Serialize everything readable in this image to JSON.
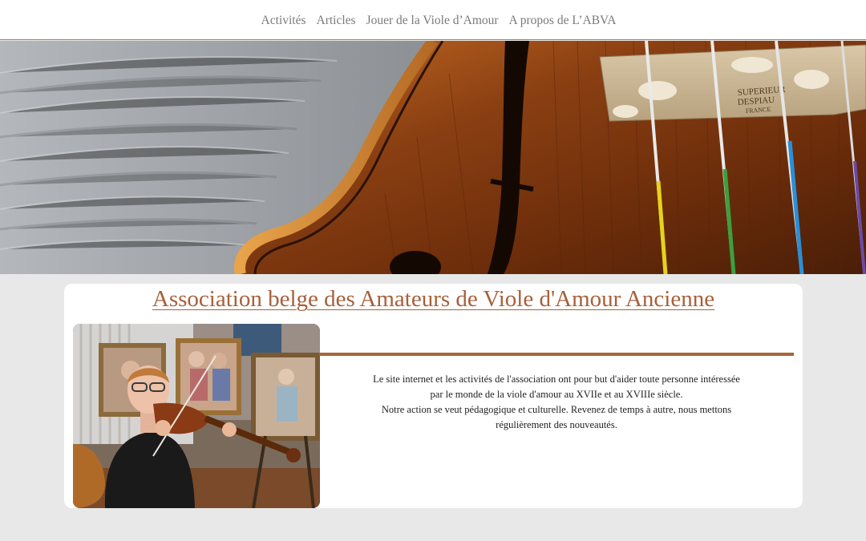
{
  "nav": {
    "items": [
      {
        "label": "Activités"
      },
      {
        "label": "Articles"
      },
      {
        "label": "Jouer de la Viole d’Amour"
      },
      {
        "label": "A propos de L’ABVA"
      }
    ]
  },
  "hero": {
    "image_alt": "violin-scroll-photo",
    "bridge_stamp_line1": "SUPERIEUR",
    "bridge_stamp_line2": "DESPIAU",
    "bridge_stamp_line3": "FRANCE"
  },
  "main": {
    "title": "Association belge des Amateurs de Viole d'Amour Ancienne",
    "intro_lines": [
      "Le site internet et les activités de l'association ont pour but d'aider toute personne intéressée",
      "par le monde de la viole d'amour au XVIIe et au XVIIIe siècle.",
      "Notre action se veut pédagogique et culturelle. Revenez de temps à autre, nous mettons",
      "régulièrement des nouveautés."
    ]
  },
  "colors": {
    "accent": "#a8603a",
    "nav_text": "#7a7a7a",
    "page_bg": "#e8e8e8"
  }
}
